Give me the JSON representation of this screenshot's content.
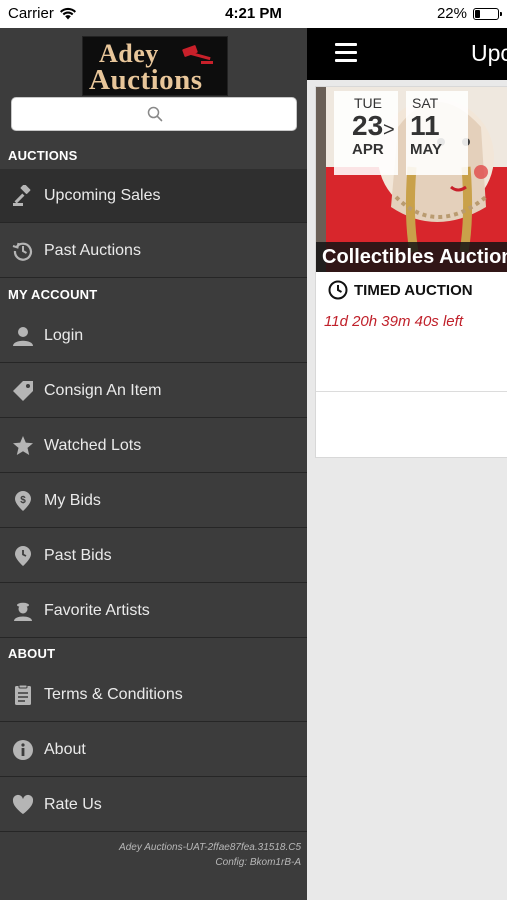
{
  "status_bar": {
    "carrier": "Carrier",
    "time": "4:21 PM",
    "battery": "22%",
    "battery_level": 0.22
  },
  "logo": {
    "line1": "Adey",
    "line2": "Auctions"
  },
  "search": {
    "icon": "search-icon"
  },
  "sidebar": {
    "sections": [
      {
        "header": "AUCTIONS",
        "items": [
          {
            "label": "Upcoming Sales",
            "icon": "gavel-icon",
            "active": true
          },
          {
            "label": "Past Auctions",
            "icon": "history-icon"
          }
        ]
      },
      {
        "header": "MY ACCOUNT",
        "items": [
          {
            "label": "Login",
            "icon": "user-icon"
          },
          {
            "label": "Consign An Item",
            "icon": "tag-icon"
          },
          {
            "label": "Watched Lots",
            "icon": "star-icon"
          },
          {
            "label": "My Bids",
            "icon": "bid-dollar-icon"
          },
          {
            "label": "Past Bids",
            "icon": "past-bid-icon"
          },
          {
            "label": "Favorite Artists",
            "icon": "artist-icon"
          }
        ]
      },
      {
        "header": "ABOUT",
        "items": [
          {
            "label": "Terms & Conditions",
            "icon": "document-icon"
          },
          {
            "label": "About",
            "icon": "info-icon"
          },
          {
            "label": "Rate Us",
            "icon": "heart-icon"
          }
        ]
      }
    ],
    "footer_version": "Adey Auctions-UAT-2ffae87fea.31518.C5",
    "footer_config": "Config: Bkom1rB-A"
  },
  "topbar": {
    "title": "Upcoming Sales"
  },
  "auction_card": {
    "start": {
      "dow": "TUE",
      "day": "23",
      "month": "APR"
    },
    "arrow": ">",
    "end": {
      "dow": "SAT",
      "day": "11",
      "month": "MAY"
    },
    "title": "Collectibles Auction",
    "type": "TIMED AUCTION",
    "time_left": "11d 20h 39m 40s left"
  },
  "colors": {
    "sidebar_bg": "#3c3c3c",
    "active_bg": "#2f2f2f",
    "accent_red": "#c0202a",
    "logo_gold": "#e8c69a"
  }
}
